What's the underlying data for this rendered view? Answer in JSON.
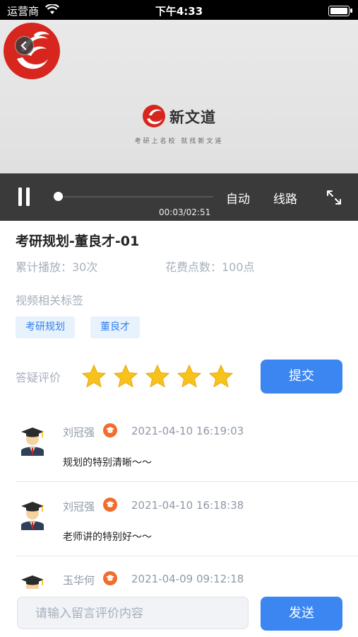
{
  "status_bar": {
    "carrier": "运营商",
    "time": "下午4:33"
  },
  "video": {
    "brand_title": "新文道",
    "slogan": "考研上名校  就找新文道",
    "controls": {
      "auto_label": "自动",
      "route_label": "线路",
      "timecode": "00:03/02:51",
      "progress": 0.017
    }
  },
  "info": {
    "title": "考研规划-董良才-01",
    "plays": "累计播放：30次",
    "cost": "花费点数：100点",
    "tags_label": "视频相关标签",
    "tags": [
      "考研规划",
      "董良才"
    ]
  },
  "rating": {
    "label": "答疑评价",
    "stars": 5,
    "star_color": "#f7c21b",
    "submit_label": "提交"
  },
  "comments": [
    {
      "name": "刘冠强",
      "time": "2021-04-10 16:19:03",
      "text": "规划的特别清晰～～"
    },
    {
      "name": "刘冠强",
      "time": "2021-04-10 16:18:38",
      "text": "老师讲的特别好～～"
    },
    {
      "name": "玉华何",
      "time": "2021-04-09 09:12:18",
      "text": ""
    }
  ],
  "composer": {
    "placeholder": "请输入留言评价内容",
    "send_label": "发送"
  },
  "colors": {
    "accent": "#3b86f0",
    "badge": "#f06d2c",
    "muted": "#a6b0bd",
    "brand_red": "#d7261e"
  }
}
